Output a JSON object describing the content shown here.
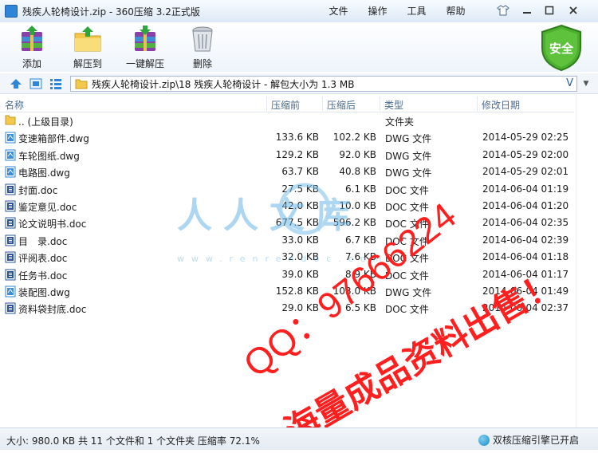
{
  "window": {
    "title": "残疾人轮椅设计.zip - 360压缩 3.2正式版",
    "menus": [
      "文件",
      "操作",
      "工具",
      "帮助"
    ]
  },
  "toolbar": {
    "add_label": "添加",
    "extract_to_label": "解压到",
    "oneclick_label": "一键解压",
    "delete_label": "删除",
    "safe_label": "安全"
  },
  "address": {
    "path": "残疾人轮椅设计.zip\\18 残疾人轮椅设计 - 解包大小为 1.3 MB",
    "dropdown_icon": "V"
  },
  "columns": {
    "name": "名称",
    "compressed_before": "压缩前",
    "compressed_after": "压缩后",
    "type": "类型",
    "modified": "修改日期"
  },
  "files": [
    {
      "name": ".. (上级目录)",
      "before": "",
      "after": "",
      "type": "文件夹",
      "date": "",
      "icon": "folder-icon"
    },
    {
      "name": "变速箱部件.dwg",
      "before": "133.6 KB",
      "after": "102.2 KB",
      "type": "DWG 文件",
      "date": "2014-05-29 02:25",
      "icon": "dwg-file-icon"
    },
    {
      "name": "车轮图纸.dwg",
      "before": "129.2 KB",
      "after": "92.0 KB",
      "type": "DWG 文件",
      "date": "2014-05-29 02:00",
      "icon": "dwg-file-icon"
    },
    {
      "name": "电路图.dwg",
      "before": "63.7 KB",
      "after": "40.8 KB",
      "type": "DWG 文件",
      "date": "2014-05-29 02:01",
      "icon": "dwg-file-icon"
    },
    {
      "name": "封面.doc",
      "before": "27.5 KB",
      "after": "6.1 KB",
      "type": "DOC 文件",
      "date": "2014-06-04 01:19",
      "icon": "doc-file-icon"
    },
    {
      "name": "鉴定意见.doc",
      "before": "42.0 KB",
      "after": "10.0 KB",
      "type": "DOC 文件",
      "date": "2014-06-04 01:20",
      "icon": "doc-file-icon"
    },
    {
      "name": "论文说明书.doc",
      "before": "677.5 KB",
      "after": "596.2 KB",
      "type": "DOC 文件",
      "date": "2014-06-04 02:35",
      "icon": "doc-file-icon"
    },
    {
      "name": "目　录.doc",
      "before": "33.0 KB",
      "after": "6.7 KB",
      "type": "DOC 文件",
      "date": "2014-06-04 02:39",
      "icon": "doc-file-icon"
    },
    {
      "name": "评阅表.doc",
      "before": "32.0 KB",
      "after": "7.6 KB",
      "type": "DOC 文件",
      "date": "2014-06-04 01:18",
      "icon": "doc-file-icon"
    },
    {
      "name": "任务书.doc",
      "before": "39.0 KB",
      "after": "8.9 KB",
      "type": "DOC 文件",
      "date": "2014-06-04 01:17",
      "icon": "doc-file-icon"
    },
    {
      "name": "装配图.dwg",
      "before": "152.8 KB",
      "after": "103.0 KB",
      "type": "DWG 文件",
      "date": "2014-06-04 01:49",
      "icon": "dwg-file-icon"
    },
    {
      "name": "资料袋封底.doc",
      "before": "29.0 KB",
      "after": "6.5 KB",
      "type": "DOC 文件",
      "date": "2014-06-04 02:37",
      "icon": "doc-file-icon"
    }
  ],
  "status": {
    "summary": "大小: 980.0 KB 共 11 个文件和 1 个文件夹 压缩率 72.1%",
    "engine": "双核压缩引擎已开启"
  },
  "watermark": {
    "logo_text": "人人文库",
    "url_text": "www.renrendoc.com",
    "qq_text": "QQ：97666224",
    "sale_text": "海量成品资料出售！"
  },
  "colors": {
    "accent": "#2f86d8",
    "safe_green": "#4caf2e",
    "watermark_red": "#ff1f1f",
    "header_text": "#4d6a8c"
  }
}
